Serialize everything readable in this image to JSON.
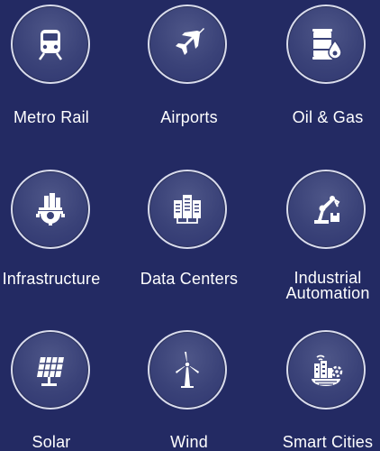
{
  "industries": [
    {
      "label": "Metro Rail",
      "icon": "train-icon"
    },
    {
      "label": "Airports",
      "icon": "airplane-icon"
    },
    {
      "label": "Oil & Gas",
      "icon": "oil-barrel-icon"
    },
    {
      "label": "Infrastructure",
      "icon": "infrastructure-gear-icon"
    },
    {
      "label": "Data Centers",
      "icon": "server-rack-icon"
    },
    {
      "label": "Industrial",
      "label2": "Automation",
      "icon": "robot-arm-icon"
    },
    {
      "label": "Solar",
      "icon": "solar-panel-icon"
    },
    {
      "label": "Wind",
      "icon": "wind-turbine-icon"
    },
    {
      "label": "Smart Cities",
      "icon": "smart-city-icon"
    }
  ],
  "colors": {
    "background": "#232a63",
    "circle": "#3a4278",
    "ring": "#d9dcec",
    "text": "#ffffff"
  }
}
